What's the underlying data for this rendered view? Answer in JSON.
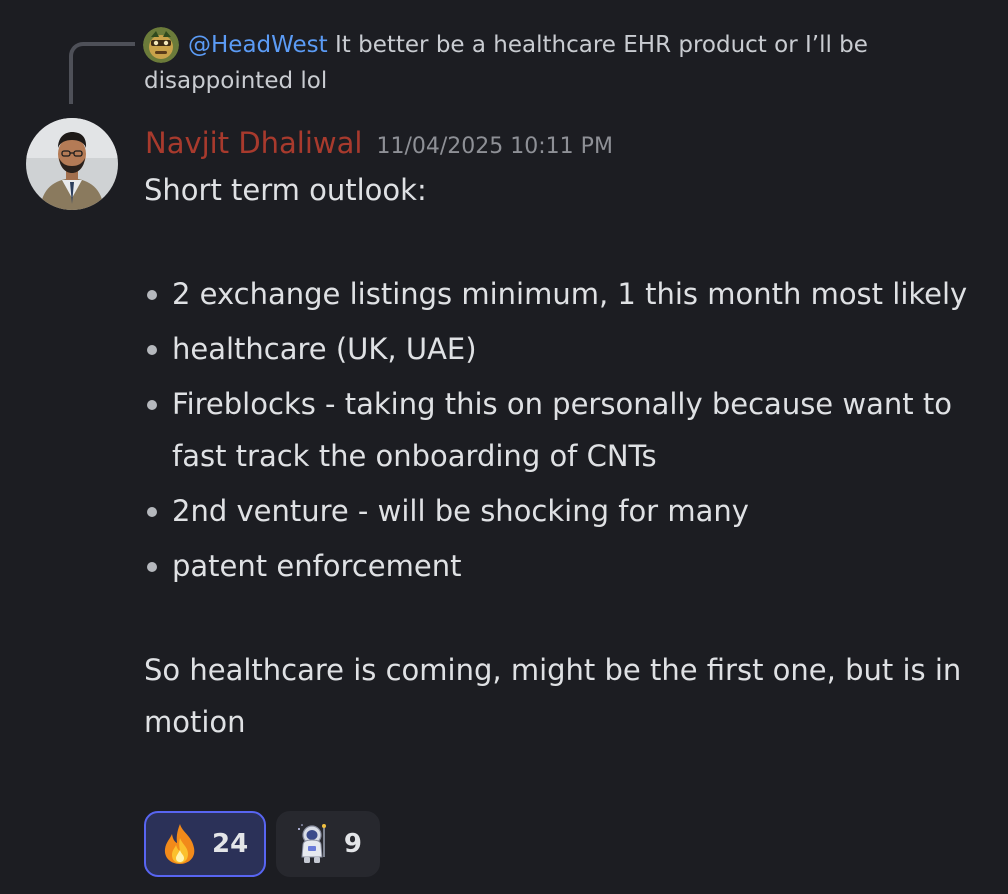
{
  "reply": {
    "mention": "@HeadWest",
    "text": " It better be a healthcare EHR product or I’ll be disappointed lol"
  },
  "message": {
    "author": "Navjit Dhaliwal",
    "timestamp": "11/04/2025 10:11 PM",
    "intro": "Short term outlook:",
    "bullets": [
      "2 exchange listings minimum, 1 this month most likely",
      "healthcare (UK, UAE)",
      "Fireblocks - taking this on personally because want to fast track the onboarding of CNTs",
      "2nd venture - will be shocking for many",
      "patent enforcement"
    ],
    "outro": "So healthcare is coming, might be the first one, but is in motion"
  },
  "reactions": [
    {
      "emoji": "fire-emoji",
      "count": "24",
      "active": true
    },
    {
      "emoji": "astronaut-emoji",
      "count": "9",
      "active": false
    }
  ],
  "colors": {
    "background": "#1c1d22",
    "author": "#a83a2d",
    "mention": "#5b9bf5",
    "reaction_active_border": "#5865f2"
  }
}
